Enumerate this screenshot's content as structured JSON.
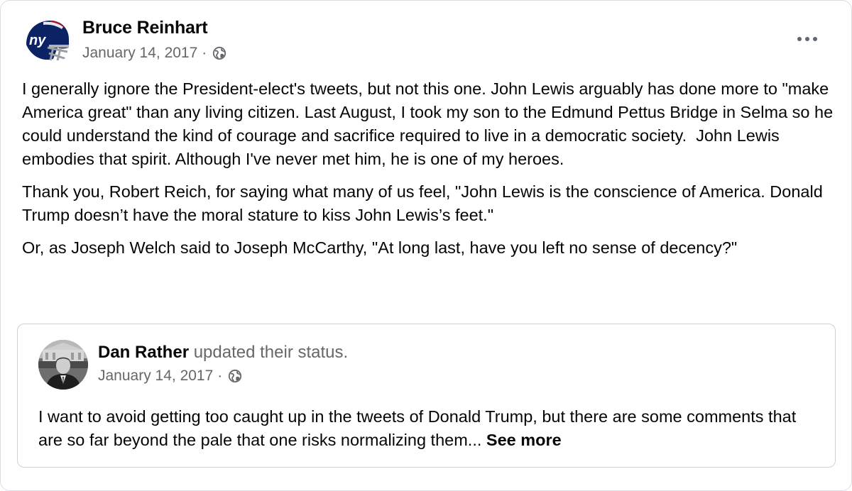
{
  "post": {
    "author": "Bruce Reinhart",
    "date": "January 14, 2017",
    "separator": "·",
    "privacy_icon": "globe-icon",
    "avatar_icon": "football-helmet-icon",
    "more_icon": "more-horizontal-icon",
    "avatar_text": "ny",
    "paragraphs": [
      "I generally ignore the President-elect's tweets, but not this one. John Lewis arguably has done more to \"make America great\" than any living citizen. Last August, I took my son to the Edmund Pettus Bridge in Selma so he could understand the kind of courage and sacrifice required to live in a democratic society.  John Lewis embodies that spirit. Although I've never met him, he is one of my heroes.",
      "Thank you, Robert Reich, for saying what many of us feel, \"John Lewis is the conscience of America. Donald Trump doesn’t have the moral stature to kiss John Lewis’s feet.\"",
      "Or, as Joseph Welch said to Joseph McCarthy, \"At long last, have you left no sense of decency?\""
    ]
  },
  "shared": {
    "author": "Dan Rather",
    "action": "updated their status.",
    "date": "January 14, 2017",
    "separator": "·",
    "privacy_icon": "globe-icon",
    "avatar_icon": "profile-photo",
    "text": "I want to avoid getting too caught up in the tweets of Donald Trump, but there are some comments that are so far beyond the pale that one risks normalizing them... ",
    "see_more": "See more"
  },
  "colors": {
    "text": "#050505",
    "secondary": "#65676b",
    "border": "#ced0d4",
    "giants_blue": "#0b2265",
    "giants_red": "#a71930"
  }
}
